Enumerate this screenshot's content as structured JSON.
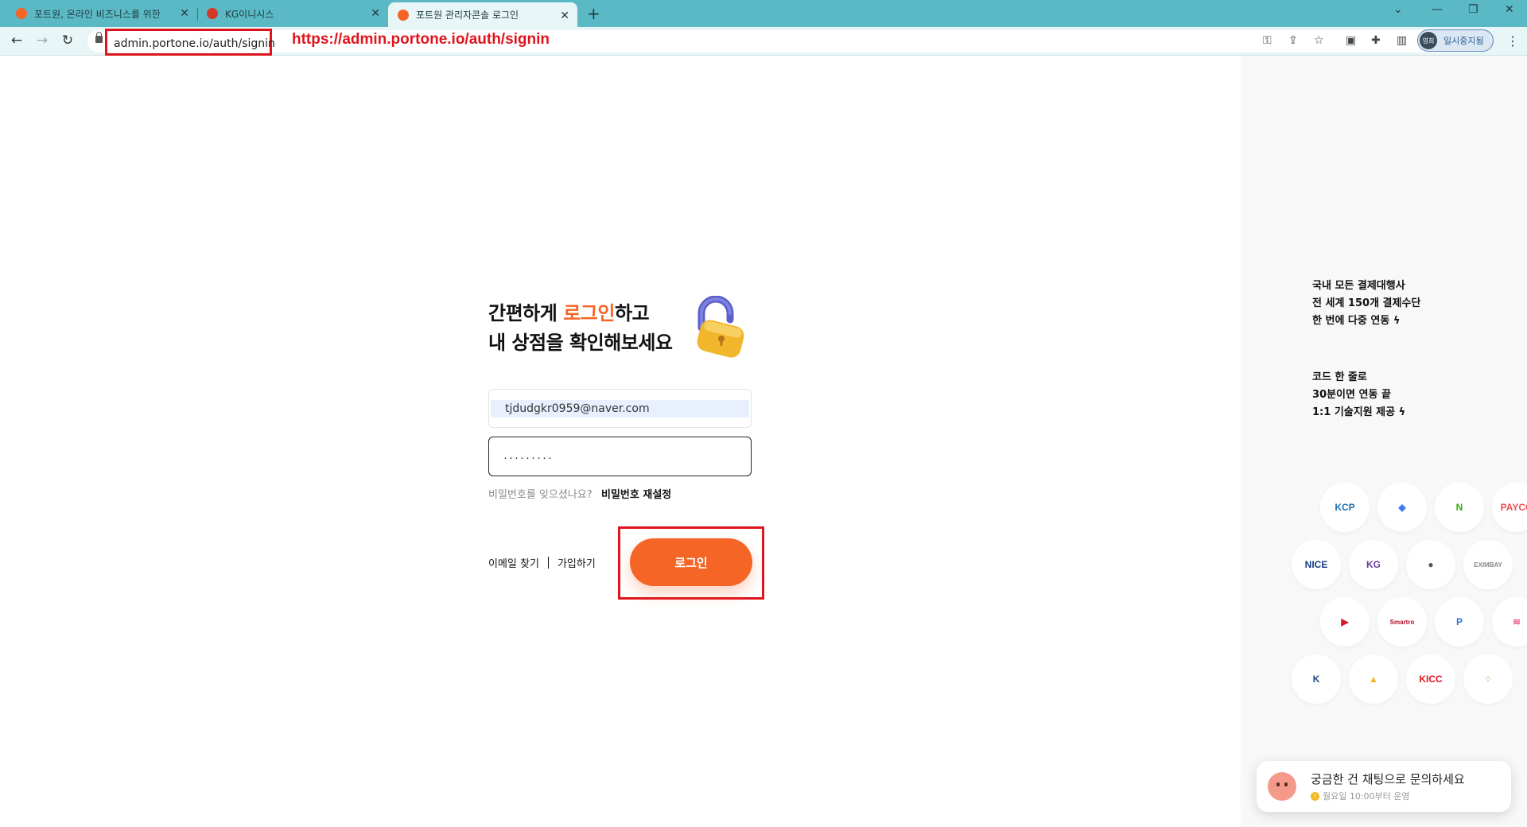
{
  "browser": {
    "tabs": [
      {
        "title": "포트원, 온라인 비즈니스를 위한",
        "favicon_color": "#f46526"
      },
      {
        "title": "KG이니시스",
        "favicon_color": "#d33a2c"
      },
      {
        "title": "포트원 관리자콘솔 로그인",
        "favicon_color": "#f46526"
      }
    ],
    "url": "admin.portone.io/auth/signin",
    "url_annotation": "https://admin.portone.io/auth/signin",
    "profile_initials": "영희",
    "profile_label": "일시중지됨"
  },
  "login": {
    "heading_part1": "간편하게 ",
    "heading_accent": "로그인",
    "heading_part2": "하고",
    "heading_line2": "내 상점을 확인해보세요",
    "email_value": "tjdudgkr0959@naver.com",
    "password_masked": "·········",
    "forgot_text": "비밀번호를 잊으셨나요?",
    "reset_link": "비밀번호 재설정",
    "find_email": "이메일 찾기",
    "signup": "가입하기",
    "login_button": "로그인"
  },
  "promo": {
    "block1": [
      "국내 모든 결제대행사",
      "전 세계 150개 결제수단",
      "한 번에 다중 연동"
    ],
    "block2": [
      "코드 한 줄로",
      "30분이면 연동 끝",
      "1:1 기술지원 제공"
    ]
  },
  "partner_logos": [
    {
      "name": "kcp-logo",
      "text": "KCP",
      "color": "#1b6fb8"
    },
    {
      "name": "toss-logo",
      "text": "◆",
      "color": "#3e7df0"
    },
    {
      "name": "naverpay-logo",
      "text": "N",
      "color": "#2db400"
    },
    {
      "name": "payco-logo",
      "text": "PAYCO",
      "color": "#f04b4b"
    },
    {
      "name": "nice-logo",
      "text": "NICE",
      "color": "#1a3b8a"
    },
    {
      "name": "kg-logo",
      "text": "KG",
      "color": "#6b3aa0"
    },
    {
      "name": "kakaopay-logo",
      "text": "●",
      "color": "#555555"
    },
    {
      "name": "eximbay-logo",
      "text": "EXIMBAY",
      "color": "#8a8a8a"
    },
    {
      "name": "daou-logo",
      "text": "▶",
      "color": "#d6182a"
    },
    {
      "name": "smartro-logo",
      "text": "Smartro",
      "color": "#b0122a"
    },
    {
      "name": "paypal-logo",
      "text": "P",
      "color": "#2f6fd6"
    },
    {
      "name": "settle-logo",
      "text": "≋",
      "color": "#f25b8a"
    },
    {
      "name": "ksnet-logo",
      "text": "K",
      "color": "#1e4a8a"
    },
    {
      "name": "blockchain-logo",
      "text": "▲",
      "color": "#f2b824"
    },
    {
      "name": "kicc-logo",
      "text": "KICC",
      "color": "#e0141d"
    },
    {
      "name": "welcome-logo",
      "text": "⁘",
      "color": "#d7c08a"
    }
  ],
  "chat": {
    "title": "궁금한 건 채팅으로 문의하세요",
    "subtitle": "월요일 10:00부터 운영"
  }
}
